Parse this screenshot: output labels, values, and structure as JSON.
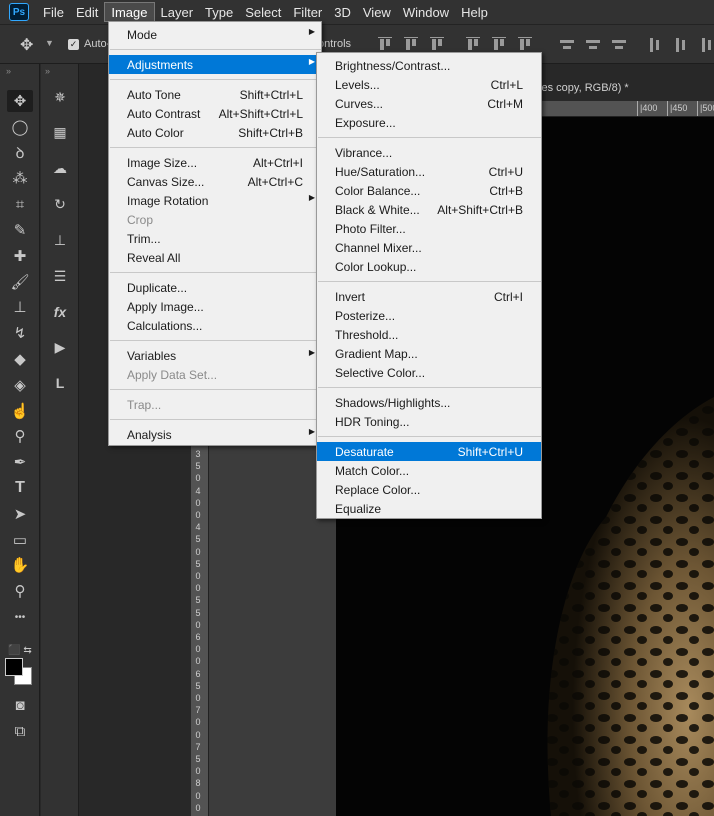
{
  "app": {
    "logo_text": "Ps"
  },
  "menubar": {
    "items": [
      "File",
      "Edit",
      "Image",
      "Layer",
      "Type",
      "Select",
      "Filter",
      "3D",
      "View",
      "Window",
      "Help"
    ],
    "active_index": 2
  },
  "options": {
    "auto_select_label": "Auto-",
    "transform_controls_label": "ontrols"
  },
  "document": {
    "tab_title": "yes copy, RGB/8) *",
    "h_ruler_ticks": [
      "|400",
      "|450",
      "|500",
      "|55"
    ],
    "v_ruler_ticks": [
      "3",
      "5",
      "0",
      "4",
      "0",
      "0",
      "4",
      "5",
      "0",
      "5",
      "0",
      "0",
      "5",
      "5",
      "0",
      "6",
      "0",
      "0",
      "6",
      "5",
      "0",
      "7",
      "0",
      "0",
      "7",
      "5",
      "0",
      "8",
      "0",
      "0"
    ]
  },
  "image_menu": {
    "items": [
      {
        "label": "Mode",
        "submenu": true
      },
      {
        "sep": true
      },
      {
        "label": "Adjustments",
        "submenu": true,
        "highlight": true
      },
      {
        "sep": true
      },
      {
        "label": "Auto Tone",
        "shortcut": "Shift+Ctrl+L"
      },
      {
        "label": "Auto Contrast",
        "shortcut": "Alt+Shift+Ctrl+L"
      },
      {
        "label": "Auto Color",
        "shortcut": "Shift+Ctrl+B"
      },
      {
        "sep": true
      },
      {
        "label": "Image Size...",
        "shortcut": "Alt+Ctrl+I"
      },
      {
        "label": "Canvas Size...",
        "shortcut": "Alt+Ctrl+C"
      },
      {
        "label": "Image Rotation",
        "submenu": true
      },
      {
        "label": "Crop",
        "disabled": true
      },
      {
        "label": "Trim..."
      },
      {
        "label": "Reveal All"
      },
      {
        "sep": true
      },
      {
        "label": "Duplicate..."
      },
      {
        "label": "Apply Image..."
      },
      {
        "label": "Calculations..."
      },
      {
        "sep": true
      },
      {
        "label": "Variables",
        "submenu": true
      },
      {
        "label": "Apply Data Set...",
        "disabled": true
      },
      {
        "sep": true
      },
      {
        "label": "Trap...",
        "disabled": true
      },
      {
        "sep": true
      },
      {
        "label": "Analysis",
        "submenu": true
      }
    ]
  },
  "adjustments_menu": {
    "items": [
      {
        "label": "Brightness/Contrast..."
      },
      {
        "label": "Levels...",
        "shortcut": "Ctrl+L"
      },
      {
        "label": "Curves...",
        "shortcut": "Ctrl+M"
      },
      {
        "label": "Exposure..."
      },
      {
        "sep": true
      },
      {
        "label": "Vibrance..."
      },
      {
        "label": "Hue/Saturation...",
        "shortcut": "Ctrl+U"
      },
      {
        "label": "Color Balance...",
        "shortcut": "Ctrl+B"
      },
      {
        "label": "Black & White...",
        "shortcut": "Alt+Shift+Ctrl+B"
      },
      {
        "label": "Photo Filter..."
      },
      {
        "label": "Channel Mixer..."
      },
      {
        "label": "Color Lookup..."
      },
      {
        "sep": true
      },
      {
        "label": "Invert",
        "shortcut": "Ctrl+I"
      },
      {
        "label": "Posterize..."
      },
      {
        "label": "Threshold..."
      },
      {
        "label": "Gradient Map..."
      },
      {
        "label": "Selective Color..."
      },
      {
        "sep": true
      },
      {
        "label": "Shadows/Highlights..."
      },
      {
        "label": "HDR Toning..."
      },
      {
        "sep": true
      },
      {
        "label": "Desaturate",
        "shortcut": "Shift+Ctrl+U",
        "highlight": true
      },
      {
        "label": "Match Color..."
      },
      {
        "label": "Replace Color..."
      },
      {
        "label": "Equalize"
      }
    ]
  },
  "toolbar": {
    "tools": [
      {
        "name": "move-tool-icon",
        "glyph": "✥",
        "selected": true
      },
      {
        "name": "elliptical-marquee-icon",
        "glyph": "◯"
      },
      {
        "name": "lasso-icon",
        "glyph": "ꝺ"
      },
      {
        "name": "magic-wand-icon",
        "glyph": "⁂"
      },
      {
        "name": "crop-icon",
        "glyph": "⌗"
      },
      {
        "name": "eyedropper-icon",
        "glyph": "✎"
      },
      {
        "name": "healing-brush-icon",
        "glyph": "✚"
      },
      {
        "name": "brush-icon",
        "glyph": "🖌"
      },
      {
        "name": "clone-stamp-icon",
        "glyph": "⊥"
      },
      {
        "name": "history-brush-icon",
        "glyph": "↯"
      },
      {
        "name": "eraser-icon",
        "glyph": "◆"
      },
      {
        "name": "paint-bucket-icon",
        "glyph": "◈"
      },
      {
        "name": "smudge-icon",
        "glyph": "☝"
      },
      {
        "name": "dodge-icon",
        "glyph": "⚲"
      },
      {
        "name": "pen-icon",
        "glyph": "✒"
      },
      {
        "name": "type-tool-icon",
        "glyph": "T"
      },
      {
        "name": "path-selection-icon",
        "glyph": "➤"
      },
      {
        "name": "rectangle-tool-icon",
        "glyph": "▭"
      },
      {
        "name": "hand-tool-icon",
        "glyph": "✋"
      },
      {
        "name": "zoom-tool-icon",
        "glyph": "⚲"
      },
      {
        "name": "more-tools-icon",
        "glyph": "•••"
      }
    ],
    "bottom": [
      {
        "name": "quick-mask-icon",
        "glyph": "◙"
      },
      {
        "name": "screen-mode-icon",
        "glyph": "⧉"
      }
    ]
  },
  "panel_column": {
    "icons": [
      {
        "name": "navigator-panel-icon",
        "glyph": "✵"
      },
      {
        "name": "properties-panel-icon",
        "glyph": "▦"
      },
      {
        "name": "libraries-panel-icon",
        "glyph": "☁"
      },
      {
        "name": "history-panel-icon",
        "glyph": "↻"
      },
      {
        "name": "clone-source-panel-icon",
        "glyph": "⊥"
      },
      {
        "name": "paragraph-panel-icon",
        "glyph": "☰"
      },
      {
        "name": "styles-panel-icon",
        "glyph": "fx"
      },
      {
        "name": "actions-panel-icon",
        "glyph": "▶"
      },
      {
        "name": "layer-comps-panel-icon",
        "glyph": "L"
      }
    ]
  },
  "colors": {
    "menu_highlight": "#0078d7",
    "ps_blue": "#31a8ff",
    "foreground_swatch": "#000000",
    "background_swatch": "#ffffff"
  }
}
